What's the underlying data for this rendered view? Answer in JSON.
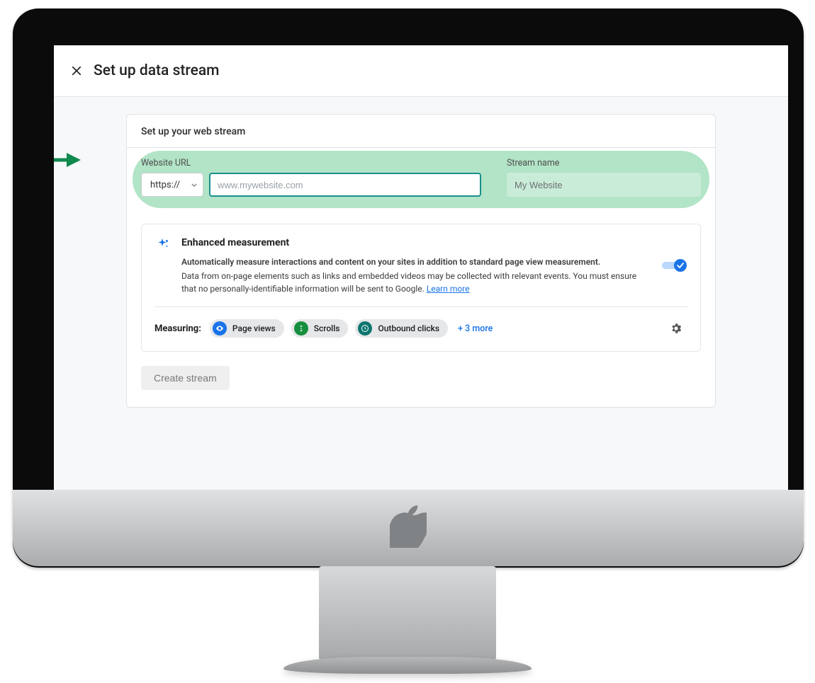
{
  "header": {
    "title": "Set up data stream"
  },
  "card": {
    "header": "Set up your web stream",
    "url_label": "Website URL",
    "protocol": "https://",
    "url_placeholder": "www.mywebsite.com",
    "name_label": "Stream name",
    "name_placeholder": "My Website"
  },
  "enhanced": {
    "title": "Enhanced measurement",
    "desc1": "Automatically measure interactions and content on your sites in addition to standard page view measurement.",
    "desc2": "Data from on-page elements such as links and embedded videos may be collected with relevant events. You must ensure that no personally-identifiable information will be sent to Google. ",
    "learn_more": "Learn more",
    "measuring_label": "Measuring:",
    "chips": [
      {
        "label": "Page views",
        "color": "#1a73e8"
      },
      {
        "label": "Scrolls",
        "color": "#158f3e"
      },
      {
        "label": "Outbound clicks",
        "color": "#0d766e"
      }
    ],
    "more": "+ 3 more"
  },
  "create_button": "Create stream"
}
